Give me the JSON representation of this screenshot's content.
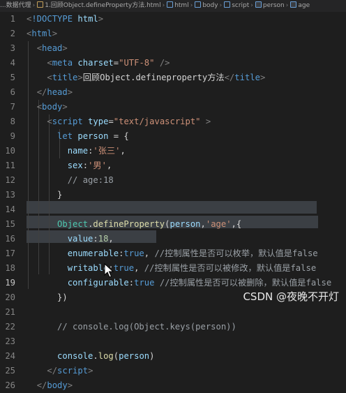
{
  "breadcrumb": {
    "items": [
      "...数据代理",
      "1.回顾Object.defineProperty方法.html",
      "html",
      "body",
      "script",
      "person",
      "age"
    ]
  },
  "editor": {
    "lines": [
      {
        "n": "1",
        "parts": [
          [
            "t-gray",
            "<"
          ],
          [
            "t-tag",
            "!DOCTYPE"
          ],
          [
            "t-punc",
            " "
          ],
          [
            "t-attr",
            "html"
          ],
          [
            "t-gray",
            ">"
          ]
        ]
      },
      {
        "n": "2",
        "parts": [
          [
            "t-gray",
            "<"
          ],
          [
            "t-tag",
            "html"
          ],
          [
            "t-gray",
            ">"
          ]
        ]
      },
      {
        "n": "3",
        "parts": [
          [
            "t-punc",
            "  "
          ],
          [
            "t-gray",
            "<"
          ],
          [
            "t-tag",
            "head"
          ],
          [
            "t-gray",
            ">"
          ]
        ]
      },
      {
        "n": "4",
        "parts": [
          [
            "t-punc",
            "    "
          ],
          [
            "t-gray",
            "<"
          ],
          [
            "t-tag",
            "meta"
          ],
          [
            "t-punc",
            " "
          ],
          [
            "t-attr",
            "charset"
          ],
          [
            "t-punc",
            "="
          ],
          [
            "t-str",
            "\"UTF-8\""
          ],
          [
            "t-punc",
            " "
          ],
          [
            "t-gray",
            "/>"
          ]
        ]
      },
      {
        "n": "5",
        "parts": [
          [
            "t-punc",
            "    "
          ],
          [
            "t-gray",
            "<"
          ],
          [
            "t-tag",
            "title"
          ],
          [
            "t-gray",
            ">"
          ],
          [
            "t-punc",
            "回顾Object.defineproperty方法"
          ],
          [
            "t-gray",
            "</"
          ],
          [
            "t-tag",
            "title"
          ],
          [
            "t-gray",
            ">"
          ]
        ]
      },
      {
        "n": "6",
        "parts": [
          [
            "t-punc",
            "  "
          ],
          [
            "t-gray",
            "</"
          ],
          [
            "t-tag",
            "head"
          ],
          [
            "t-gray",
            ">"
          ]
        ]
      },
      {
        "n": "7",
        "parts": [
          [
            "t-punc",
            "  "
          ],
          [
            "t-gray",
            "<"
          ],
          [
            "t-tag",
            "body"
          ],
          [
            "t-gray",
            ">"
          ]
        ]
      },
      {
        "n": "8",
        "parts": [
          [
            "t-punc",
            "    "
          ],
          [
            "t-gray",
            "<"
          ],
          [
            "t-tag",
            "script"
          ],
          [
            "t-punc",
            " "
          ],
          [
            "t-attr",
            "type"
          ],
          [
            "t-punc",
            "="
          ],
          [
            "t-str",
            "\"text/javascript\""
          ],
          [
            "t-punc",
            " "
          ],
          [
            "t-gray",
            ">"
          ]
        ]
      },
      {
        "n": "9",
        "parts": [
          [
            "t-punc",
            "      "
          ],
          [
            "t-kw",
            "let"
          ],
          [
            "t-punc",
            " "
          ],
          [
            "t-var",
            "person"
          ],
          [
            "t-punc",
            " = {"
          ]
        ]
      },
      {
        "n": "10",
        "parts": [
          [
            "t-punc",
            "        "
          ],
          [
            "t-var",
            "name"
          ],
          [
            "t-punc",
            ":"
          ],
          [
            "t-str",
            "'张三'"
          ],
          [
            "t-punc",
            ","
          ]
        ]
      },
      {
        "n": "11",
        "parts": [
          [
            "t-punc",
            "        "
          ],
          [
            "t-var",
            "sex"
          ],
          [
            "t-punc",
            ":"
          ],
          [
            "t-str",
            "'男'"
          ],
          [
            "t-punc",
            ","
          ]
        ]
      },
      {
        "n": "12",
        "parts": [
          [
            "t-punc",
            "        "
          ],
          [
            "t-cm2",
            "// age:18"
          ]
        ]
      },
      {
        "n": "13",
        "parts": [
          [
            "t-punc",
            "      }"
          ]
        ]
      },
      {
        "n": "14",
        "parts": []
      },
      {
        "n": "15",
        "parts": [
          [
            "t-punc",
            "      "
          ],
          [
            "t-obj",
            "Object"
          ],
          [
            "t-punc",
            "."
          ],
          [
            "t-fn",
            "defineProperty"
          ],
          [
            "t-punc",
            "("
          ],
          [
            "t-var",
            "person"
          ],
          [
            "t-punc",
            ","
          ],
          [
            "t-str",
            "'age'"
          ],
          [
            "t-punc",
            ",{"
          ]
        ]
      },
      {
        "n": "16",
        "parts": [
          [
            "t-punc",
            "        "
          ],
          [
            "t-var",
            "value"
          ],
          [
            "t-punc",
            ":"
          ],
          [
            "t-num",
            "18"
          ],
          [
            "t-punc",
            ","
          ]
        ]
      },
      {
        "n": "17",
        "parts": [
          [
            "t-punc",
            "        "
          ],
          [
            "t-var",
            "enumerable"
          ],
          [
            "t-punc",
            ":"
          ],
          [
            "t-kw",
            "true"
          ],
          [
            "t-punc",
            ", "
          ],
          [
            "t-cm2",
            "//控制属性是否可以枚举，默认值是false"
          ]
        ]
      },
      {
        "n": "18",
        "parts": [
          [
            "t-punc",
            "        "
          ],
          [
            "t-var",
            "writable"
          ],
          [
            "t-punc",
            ":"
          ],
          [
            "t-kw",
            "true"
          ],
          [
            "t-punc",
            ", "
          ],
          [
            "t-cm2",
            "//控制属性是否可以被修改，默认值是false"
          ]
        ]
      },
      {
        "n": "19",
        "parts": [
          [
            "t-punc",
            "        "
          ],
          [
            "t-var",
            "configurable"
          ],
          [
            "t-punc",
            ":"
          ],
          [
            "t-kw",
            "true"
          ],
          [
            "t-punc",
            " "
          ],
          [
            "t-cm2",
            "//控制属性是否可以被删除，默认值是false"
          ]
        ]
      },
      {
        "n": "20",
        "parts": [
          [
            "t-punc",
            "      })"
          ]
        ]
      },
      {
        "n": "21",
        "parts": []
      },
      {
        "n": "22",
        "parts": [
          [
            "t-punc",
            "      "
          ],
          [
            "t-cm2",
            "// console.log(Object.keys(person))"
          ]
        ]
      },
      {
        "n": "23",
        "parts": []
      },
      {
        "n": "24",
        "parts": [
          [
            "t-punc",
            "      "
          ],
          [
            "t-var",
            "console"
          ],
          [
            "t-punc",
            "."
          ],
          [
            "t-fn",
            "log"
          ],
          [
            "t-punc",
            "("
          ],
          [
            "t-var",
            "person"
          ],
          [
            "t-punc",
            ")"
          ]
        ]
      },
      {
        "n": "25",
        "parts": [
          [
            "t-punc",
            "    "
          ],
          [
            "t-gray",
            "</"
          ],
          [
            "t-tag",
            "script"
          ],
          [
            "t-gray",
            ">"
          ]
        ]
      },
      {
        "n": "26",
        "parts": [
          [
            "t-punc",
            "  "
          ],
          [
            "t-gray",
            "</"
          ],
          [
            "t-tag",
            "body"
          ],
          [
            "t-gray",
            ">"
          ]
        ]
      }
    ],
    "active_line": "19"
  },
  "watermark": "CSDN @夜晚不开灯",
  "colors": {
    "background": "#1e1e1e",
    "tag": "#569cd6",
    "string": "#ce9178",
    "function": "#dcdcaa",
    "selection": "#3b3f44"
  }
}
